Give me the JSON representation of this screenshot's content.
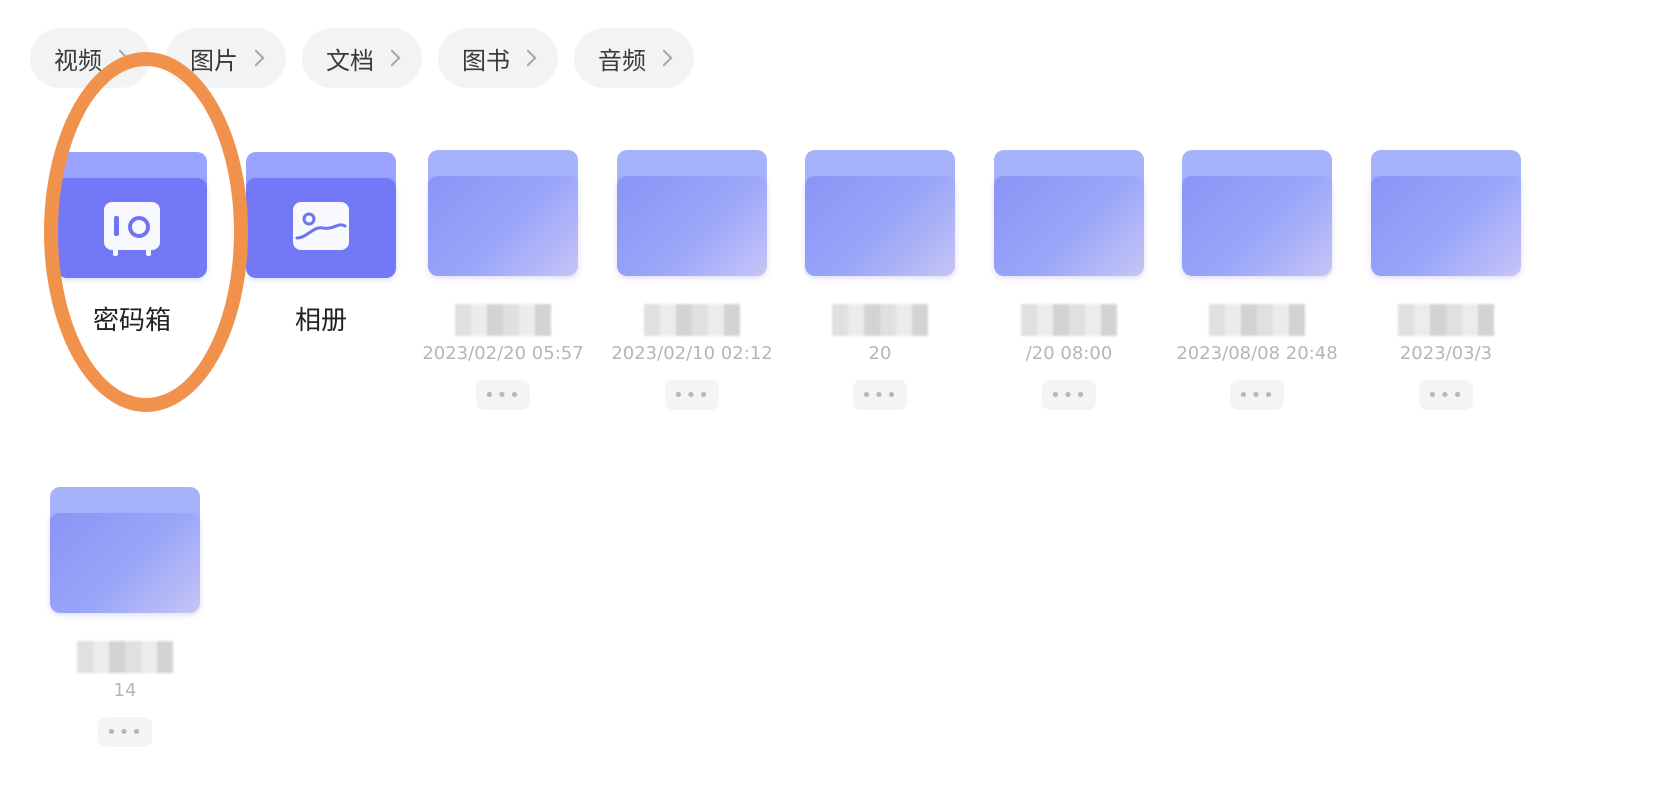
{
  "categories": [
    {
      "label": "视频"
    },
    {
      "label": "图片"
    },
    {
      "label": "文档"
    },
    {
      "label": "图书"
    },
    {
      "label": "音频"
    }
  ],
  "special_folders": [
    {
      "name": "密码箱",
      "icon": "safe-icon"
    },
    {
      "name": "相册",
      "icon": "photo-album-icon"
    }
  ],
  "folders": [
    {
      "date": "2023/02/20 05:57"
    },
    {
      "date": "2023/02/10 02:12"
    },
    {
      "date": "20"
    },
    {
      "date": "/20 08:00"
    },
    {
      "date": "2023/08/08 20:48"
    },
    {
      "date": "2023/03/3"
    },
    {
      "date": "14"
    }
  ],
  "more_label": "•••",
  "colors": {
    "annotation": "#f0924c",
    "folder_accent": "#7278f6"
  }
}
